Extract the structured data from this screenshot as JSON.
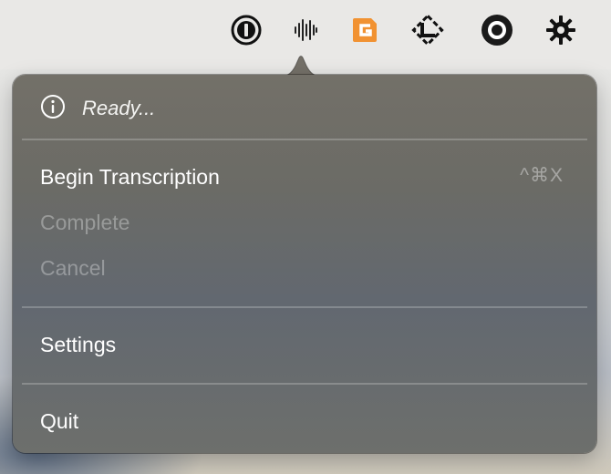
{
  "menubar": {
    "icons": [
      {
        "name": "1password-icon"
      },
      {
        "name": "waveform-icon"
      },
      {
        "name": "grammarly-icon",
        "color": "#f19232"
      },
      {
        "name": "diamond-app-icon"
      },
      {
        "name": "record-circle-icon"
      },
      {
        "name": "asterisk-burst-icon"
      }
    ]
  },
  "menu": {
    "status": {
      "icon": "info-icon",
      "text": "Ready..."
    },
    "items": [
      {
        "label": "Begin Transcription",
        "shortcut": "^⌘X",
        "enabled": true
      },
      {
        "label": "Complete",
        "enabled": false
      },
      {
        "label": "Cancel",
        "enabled": false
      },
      {
        "label": "Settings",
        "enabled": true
      },
      {
        "label": "Quit",
        "enabled": true
      }
    ]
  }
}
